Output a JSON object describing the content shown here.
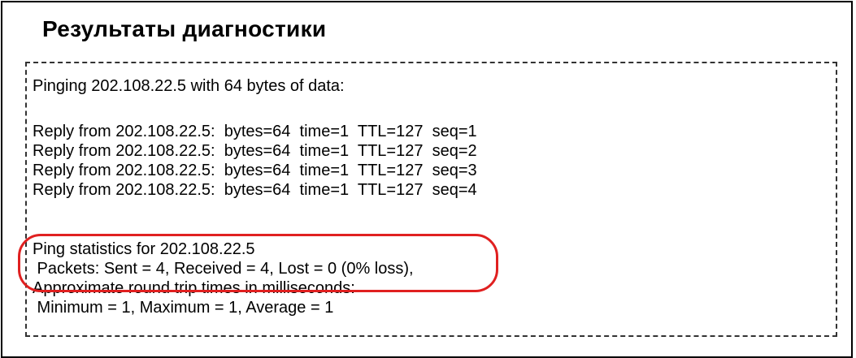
{
  "title": "Результаты диагностики",
  "results": {
    "lines": [
      "Pinging 202.108.22.5 with 64 bytes of data:",
      "Reply from 202.108.22.5:  bytes=64  time=1  TTL=127  seq=1",
      "Reply from 202.108.22.5:  bytes=64  time=1  TTL=127  seq=2",
      "Reply from 202.108.22.5:  bytes=64  time=1  TTL=127  seq=3",
      "Reply from 202.108.22.5:  bytes=64  time=1  TTL=127  seq=4",
      "Ping statistics for 202.108.22.5",
      " Packets: Sent = 4, Received = 4, Lost = 0 (0% loss),",
      "Approximate round trip times in milliseconds:",
      " Minimum = 1, Maximum = 1, Average = 1"
    ]
  },
  "highlight_color": "#e02020"
}
